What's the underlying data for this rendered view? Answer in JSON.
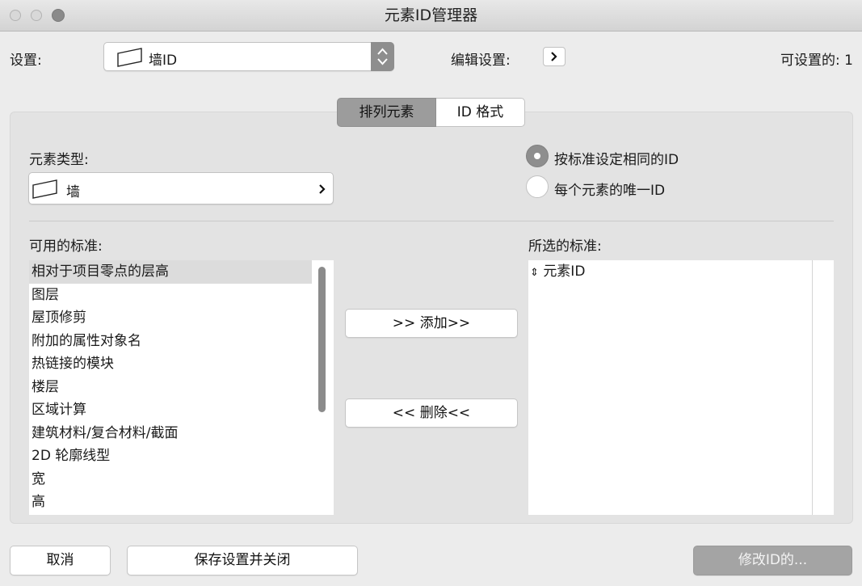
{
  "window": {
    "title": "元素ID管理器"
  },
  "settings": {
    "label": "设置:",
    "selected": "墙ID",
    "edit_label": "编辑设置:",
    "available_label": "可设置的: 1"
  },
  "tabs": [
    {
      "label": "排列元素",
      "active": true
    },
    {
      "label": "ID 格式",
      "active": false
    }
  ],
  "element_type": {
    "label": "元素类型:",
    "value": "墙"
  },
  "id_mode": {
    "options": [
      {
        "label": "按标准设定相同的ID",
        "selected": true
      },
      {
        "label": "每个元素的唯一ID",
        "selected": false
      }
    ]
  },
  "available_criteria": {
    "label": "可用的标准:",
    "items": [
      "相对于项目零点的层高",
      "图层",
      "屋顶修剪",
      "附加的属性对象名",
      "热链接的模块",
      "楼层",
      "区域计算",
      "建筑材料/复合材料/截面",
      "2D 轮廓线型",
      "宽",
      "高"
    ],
    "selected_index": 0
  },
  "actions": {
    "add": ">> 添加>>",
    "remove": "<< 删除<<"
  },
  "selected_criteria": {
    "label": "所选的标准:",
    "items": [
      {
        "icon": "⇕",
        "label": "元素ID"
      }
    ]
  },
  "footer": {
    "cancel": "取消",
    "save_close": "保存设置并关闭",
    "modify_ids": "修改ID的..."
  }
}
